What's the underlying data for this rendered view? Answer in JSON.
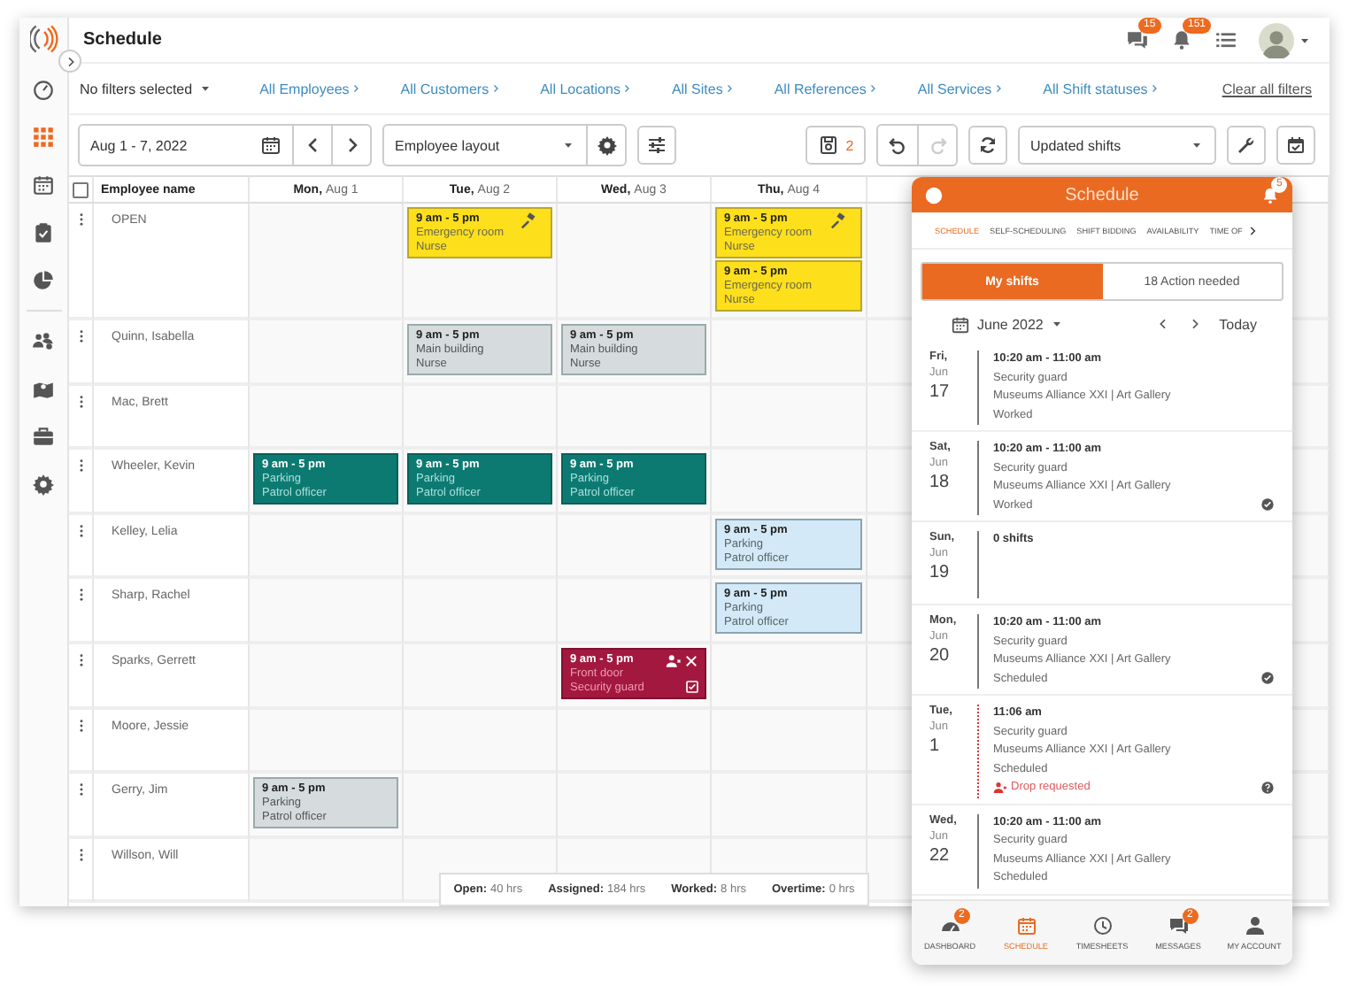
{
  "app": {
    "title": "Schedule",
    "messages_badge": "15",
    "notifications_badge": "151"
  },
  "sidebar": {
    "items": [
      {
        "kind": "gauge",
        "selected": false
      },
      {
        "kind": "grid",
        "selected": true
      },
      {
        "kind": "calendar",
        "selected": false
      },
      {
        "kind": "clipboard",
        "selected": false
      },
      {
        "kind": "pie",
        "selected": false
      },
      {
        "kind": "people",
        "selected": false
      },
      {
        "kind": "map",
        "selected": false
      },
      {
        "kind": "briefcase",
        "selected": false
      },
      {
        "kind": "gear",
        "selected": false
      }
    ]
  },
  "filters": {
    "preset": "No filters selected",
    "items": [
      "All Employees",
      "All Customers",
      "All Locations",
      "All Sites",
      "All References",
      "All Services",
      "All Shift statuses"
    ],
    "clear": "Clear all filters"
  },
  "toolbar": {
    "date_range": "Aug 1 - 7, 2022",
    "layout": "Employee layout",
    "saved_count": "2",
    "view": "Updated shifts",
    "redo_disabled": true
  },
  "grid": {
    "all_selected": false,
    "name_header": "Employee name",
    "days": [
      {
        "day": "Mon,",
        "date": "Aug 1"
      },
      {
        "day": "Tue,",
        "date": "Aug 2"
      },
      {
        "day": "Wed,",
        "date": "Aug 3"
      },
      {
        "day": "Thu,",
        "date": "Aug 4"
      }
    ],
    "rows": [
      {
        "name": "OPEN",
        "cells": [
          [],
          [
            {
              "kind": "open",
              "time": "9 am - 5 pm",
              "place": "Emergency room",
              "role": "Nurse",
              "bidding": true
            }
          ],
          [],
          [
            {
              "kind": "open",
              "time": "9 am - 5 pm",
              "place": "Emergency room",
              "role": "Nurse",
              "bidding": true
            },
            {
              "kind": "open",
              "time": "9 am - 5 pm",
              "place": "Emergency room",
              "role": "Nurse",
              "bidding": false
            }
          ]
        ]
      },
      {
        "name": "Quinn, Isabella",
        "cells": [
          [],
          [
            {
              "kind": "draft",
              "time": "9 am - 5 pm",
              "place": "Main building",
              "role": "Nurse"
            }
          ],
          [
            {
              "kind": "draft",
              "time": "9 am - 5 pm",
              "place": "Main building",
              "role": "Nurse"
            }
          ],
          []
        ]
      },
      {
        "name": "Mac, Brett",
        "cells": [
          [],
          [],
          [],
          []
        ]
      },
      {
        "name": "Wheeler, Kevin",
        "cells": [
          [
            {
              "kind": "published",
              "time": "9 am - 5 pm",
              "place": "Parking",
              "role": "Patrol officer"
            }
          ],
          [
            {
              "kind": "published",
              "time": "9 am - 5 pm",
              "place": "Parking",
              "role": "Patrol officer"
            }
          ],
          [
            {
              "kind": "published",
              "time": "9 am - 5 pm",
              "place": "Parking",
              "role": "Patrol officer"
            }
          ],
          []
        ]
      },
      {
        "name": "Kelley, Lelia",
        "cells": [
          [],
          [],
          [],
          [
            {
              "kind": "updated",
              "time": "9 am - 5 pm",
              "place": "Parking",
              "role": "Patrol officer"
            }
          ]
        ]
      },
      {
        "name": "Sharp, Rachel",
        "cells": [
          [],
          [],
          [],
          [
            {
              "kind": "updated",
              "time": "9 am - 5 pm",
              "place": "Parking",
              "role": "Patrol officer"
            }
          ]
        ]
      },
      {
        "name": "Sparks, Gerrett",
        "cells": [
          [],
          [],
          [
            {
              "kind": "dropped",
              "time": "9 am - 5 pm",
              "place": "Front door",
              "role": "Security guard"
            }
          ],
          []
        ]
      },
      {
        "name": "Moore, Jessie",
        "cells": [
          [],
          [],
          [],
          []
        ]
      },
      {
        "name": "Gerry, Jim",
        "cells": [
          [
            {
              "kind": "draft",
              "time": "9 am - 5 pm",
              "place": "Parking",
              "role": "Patrol officer"
            }
          ],
          [],
          [],
          []
        ]
      },
      {
        "name": "Willson, Will",
        "cells": [
          [],
          [],
          [],
          []
        ]
      }
    ]
  },
  "totals": [
    {
      "label": "Open:",
      "value": "40 hrs"
    },
    {
      "label": "Assigned:",
      "value": "184 hrs"
    },
    {
      "label": "Worked:",
      "value": "8 hrs"
    },
    {
      "label": "Overtime:",
      "value": "0 hrs"
    }
  ],
  "mobile": {
    "title": "Schedule",
    "bell_badge": "5",
    "tabs": [
      {
        "label": "SCHEDULE",
        "selected": true
      },
      {
        "label": "SELF-SCHEDULING",
        "selected": false
      },
      {
        "label": "SHIFT BIDDING",
        "selected": false
      },
      {
        "label": "AVAILABILITY",
        "selected": false
      },
      {
        "label": "TIME OF",
        "selected": false
      }
    ],
    "segments": [
      {
        "label": "My shifts",
        "selected": true
      },
      {
        "label": "18 Action needed",
        "selected": false
      }
    ],
    "month": "June 2022",
    "today": "Today",
    "entries": [
      {
        "kind": "shift",
        "weekday": "Fri,",
        "month": "Jun",
        "date": "17",
        "title": "10:20 am - 11:00 am",
        "role": "Security guard",
        "place": "Museums Alliance XXI | Art Gallery",
        "status": "Worked",
        "confirmed": false,
        "question": false
      },
      {
        "kind": "shift",
        "weekday": "Sat,",
        "month": "Jun",
        "date": "18",
        "title": "10:20 am - 11:00 am",
        "role": "Security guard",
        "place": "Museums Alliance XXI | Art Gallery",
        "status": "Worked",
        "confirmed": true,
        "question": false
      },
      {
        "kind": "empty",
        "weekday": "Sun,",
        "month": "Jun",
        "date": "19",
        "title": "0 shifts",
        "confirmed": false,
        "question": false
      },
      {
        "kind": "shift",
        "weekday": "Mon,",
        "month": "Jun",
        "date": "20",
        "title": "10:20 am - 11:00 am",
        "role": "Security guard",
        "place": "Museums Alliance XXI | Art Gallery",
        "status": "Scheduled",
        "confirmed": true,
        "question": false
      },
      {
        "kind": "drop",
        "weekday": "Tue,",
        "month": "Jun",
        "date": "1",
        "title": "11:06 am",
        "role": "Security guard",
        "place": "Museums Alliance XXI | Art Gallery",
        "status": "Scheduled",
        "note": "Drop requested",
        "confirmed": false,
        "question": true
      },
      {
        "kind": "shift",
        "weekday": "Wed,",
        "month": "Jun",
        "date": "22",
        "title": "10:20 am - 11:00 am",
        "role": "Security guard",
        "place": "Museums Alliance XXI | Art Gallery",
        "status": "Scheduled",
        "confirmed": false,
        "question": false
      }
    ],
    "nav": [
      {
        "kind": "dashboard",
        "label": "DASHBOARD",
        "badge": "2",
        "selected": false
      },
      {
        "kind": "calendar",
        "label": "SCHEDULE",
        "selected": true
      },
      {
        "kind": "clock",
        "label": "TIMESHEETS",
        "selected": false
      },
      {
        "kind": "chat",
        "label": "MESSAGES",
        "badge": "2",
        "selected": false
      },
      {
        "kind": "person",
        "label": "MY ACCOUNT",
        "selected": false
      }
    ]
  }
}
